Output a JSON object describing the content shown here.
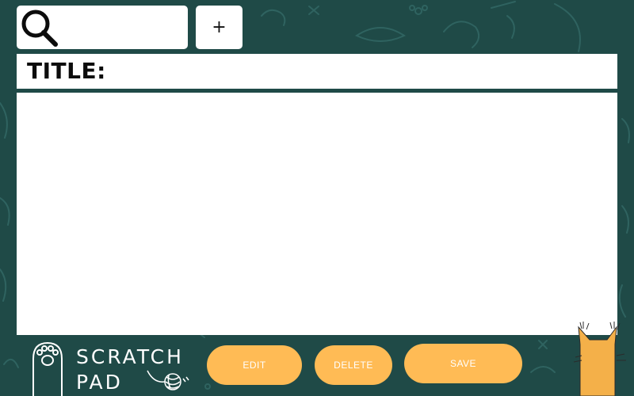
{
  "search": {
    "placeholder": "",
    "value": ""
  },
  "toolbar": {
    "add_label": "+"
  },
  "note": {
    "title_label": "TITLE:",
    "title_value": "",
    "body_value": ""
  },
  "branding": {
    "logo_line1": "SCRATCH",
    "logo_line2": "PAD"
  },
  "actions": {
    "edit_label": "EDIT",
    "delete_label": "DELETE",
    "save_label": "SAVE"
  },
  "colors": {
    "background": "#1f4a47",
    "pattern": "#2f6360",
    "panel": "#ffffff",
    "button": "#ffbb55",
    "button_text": "#ffffff",
    "cat": "#f4b049"
  },
  "icons": {
    "search": "search-icon",
    "add": "plus-icon",
    "paw": "paw-icon",
    "yarn": "yarn-ball-icon",
    "cat": "cat-peek-icon"
  }
}
